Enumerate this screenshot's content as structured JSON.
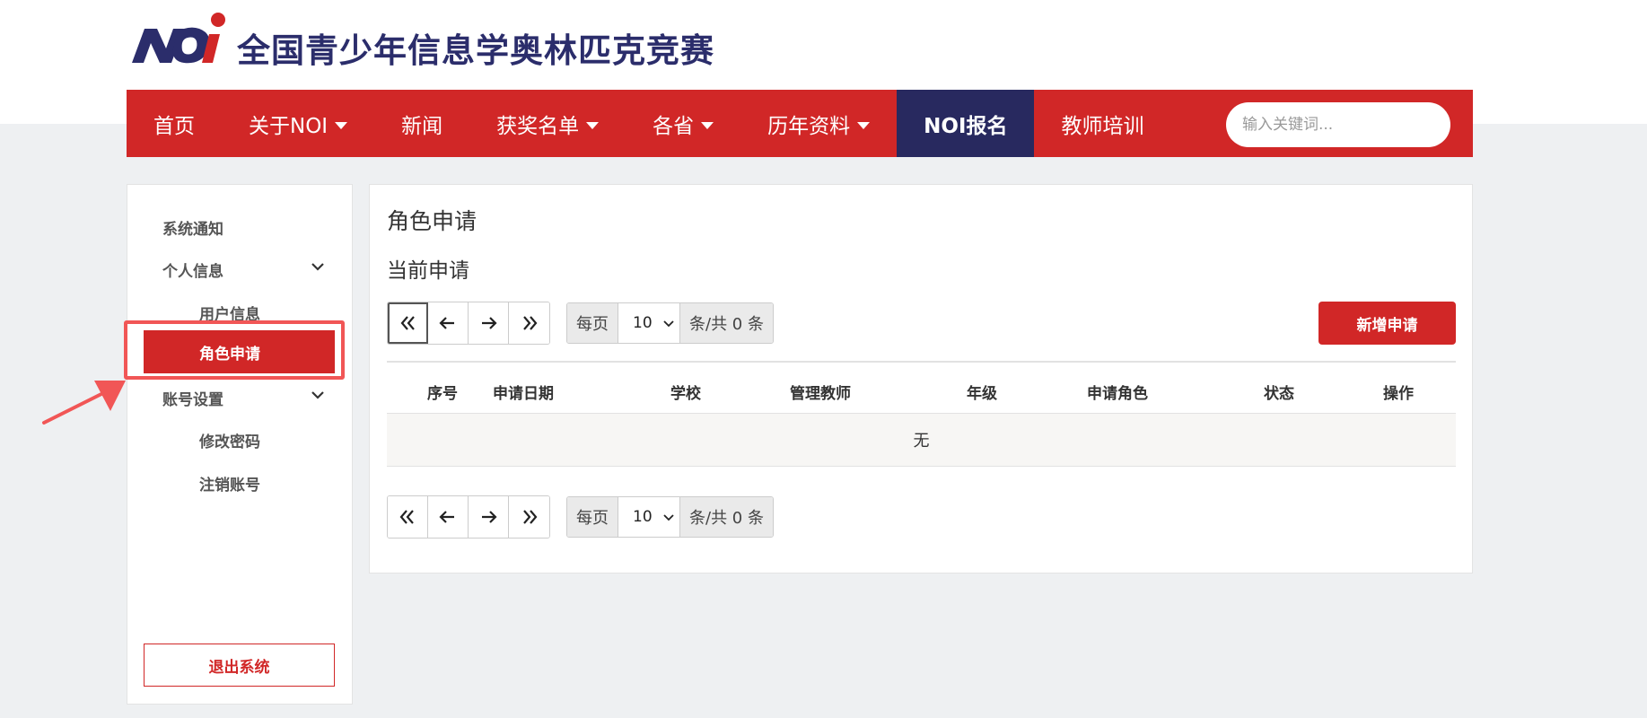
{
  "header": {
    "logo_text": "NOi",
    "site_title": "全国青少年信息学奥林匹克竞赛"
  },
  "nav": {
    "items": [
      {
        "label": "首页",
        "dropdown": false,
        "active": false
      },
      {
        "label": "关于NOI",
        "dropdown": true,
        "active": false
      },
      {
        "label": "新闻",
        "dropdown": false,
        "active": false
      },
      {
        "label": "获奖名单",
        "dropdown": true,
        "active": false
      },
      {
        "label": "各省",
        "dropdown": true,
        "active": false
      },
      {
        "label": "历年资料",
        "dropdown": true,
        "active": false
      },
      {
        "label": "NOI报名",
        "dropdown": false,
        "active": true
      },
      {
        "label": "教师培训",
        "dropdown": false,
        "active": false
      }
    ],
    "search_placeholder": "输入关键词..."
  },
  "sidebar": {
    "items": [
      {
        "label": "系统通知"
      },
      {
        "label": "个人信息"
      },
      {
        "label": "用户信息"
      },
      {
        "label": "角色申请"
      },
      {
        "label": "账号设置"
      },
      {
        "label": "修改密码"
      },
      {
        "label": "注销账号"
      }
    ],
    "logout_label": "退出系统"
  },
  "content": {
    "title": "角色申请",
    "section_title": "当前申请",
    "add_button": "新增申请",
    "pager": {
      "per_page_prefix": "每页",
      "per_page_value": "10",
      "total_text": "条/共 0 条"
    },
    "table": {
      "columns": [
        "序号",
        "申请日期",
        "学校",
        "管理教师",
        "年级",
        "申请角色",
        "状态",
        "操作"
      ],
      "empty_text": "无"
    }
  },
  "colors": {
    "brand_red": "#d12727",
    "brand_navy": "#28295f",
    "annotation": "#f15656"
  }
}
